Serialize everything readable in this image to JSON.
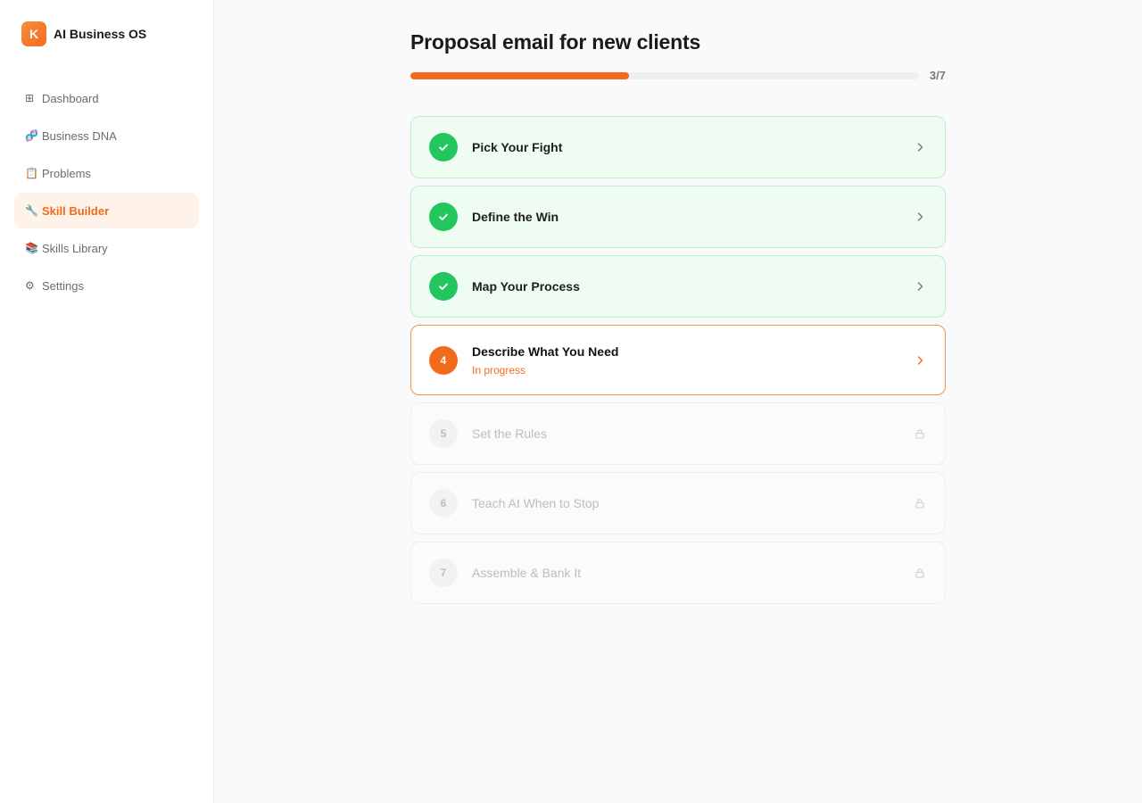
{
  "brand": {
    "logo_letter": "K",
    "name": "AI Business OS"
  },
  "sidebar": {
    "items": [
      {
        "icon": "⊞",
        "icon_name": "grid-icon",
        "label": "Dashboard",
        "active": false
      },
      {
        "icon": "🧬",
        "icon_name": "dna-icon",
        "label": "Business DNA",
        "active": false
      },
      {
        "icon": "📋",
        "icon_name": "clipboard-icon",
        "label": "Problems",
        "active": false
      },
      {
        "icon": "🔧",
        "icon_name": "wrench-icon",
        "label": "Skill Builder",
        "active": true
      },
      {
        "icon": "📚",
        "icon_name": "books-icon",
        "label": "Skills Library",
        "active": false
      },
      {
        "icon": "⚙",
        "icon_name": "gear-icon",
        "label": "Settings",
        "active": false
      }
    ]
  },
  "page": {
    "title": "Proposal email for new clients",
    "progress": {
      "current": 3,
      "total": 7,
      "label": "3/7",
      "fraction": 0.43
    }
  },
  "steps": [
    {
      "number": "1",
      "title": "Pick Your Fight",
      "status": "done"
    },
    {
      "number": "2",
      "title": "Define the Win",
      "status": "done"
    },
    {
      "number": "3",
      "title": "Map Your Process",
      "status": "done"
    },
    {
      "number": "4",
      "title": "Describe What You Need",
      "status": "current",
      "subtitle": "In progress"
    },
    {
      "number": "5",
      "title": "Set the Rules",
      "status": "locked"
    },
    {
      "number": "6",
      "title": "Teach AI When to Stop",
      "status": "locked"
    },
    {
      "number": "7",
      "title": "Assemble & Bank It",
      "status": "locked"
    }
  ],
  "colors": {
    "accent": "#f26b1d",
    "success": "#22c55e",
    "success_bg": "#eefcf2",
    "locked": "#bdbdbd"
  }
}
